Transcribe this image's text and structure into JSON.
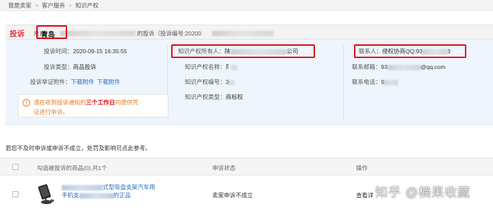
{
  "breadcrumb": [
    "我是卖家",
    "客户服务",
    "知识产权"
  ],
  "complaint": {
    "label": "投诉",
    "from_prefix": "来自",
    "city": "青岛",
    "suffix": "的投诉（投诉编号:20200"
  },
  "left_column": {
    "time_label": "投诉时间：",
    "time_value": "2020-09-15 16:35:55",
    "type_label": "投诉类型：",
    "type_value": "商品投诉",
    "attachment_label": "投诉举证附件：",
    "attachment_links": [
      "下载附件",
      "下载附件"
    ]
  },
  "notice": {
    "line1_before": "请在收到投诉通知的",
    "line1_highlight": "三个工作日",
    "line1_after": "内提供凭",
    "line2": "证进行申诉。"
  },
  "middle_column": {
    "owner_label": "知识产权所有人：",
    "owner_prefix": "陕",
    "owner_suffix": "公司",
    "name_label": "知识产权名称：",
    "name_prefix": "阝",
    "number_label": "知识产权编号：",
    "number_prefix": "3",
    "ip_type_label": "知识产权类型：",
    "ip_type_value": "商标权"
  },
  "right_column": {
    "contact_label": "联系人：",
    "contact_prefix": "侵权协商QQ:93",
    "contact_suffix": "3",
    "email_label": "联系邮箱：",
    "email_prefix": "93",
    "email_suffix": "@qq.com",
    "phone_label": "联系电话：",
    "phone_prefix": "9"
  },
  "hint": "若您不及时申诉或申诉不成立，处罚及影响可点此参考。",
  "table": {
    "headers": [
      "勾选被投诉的商品(0),共1个",
      "申诉状态",
      "操作"
    ],
    "row": {
      "name_line1_suffix": "式型吸盘支架汽车用",
      "name_line2_prefix": "手机支",
      "name_line2_suffix": "的正品",
      "status": "卖家申诉不成立",
      "action": "查看详"
    }
  },
  "watermark": "知乎 @楠果收藏",
  "colors": {
    "complaint_red": "#e4393c",
    "highlight_box": "#e4000f",
    "link_blue": "#2a6ebb",
    "warning_orange": "#e67e22",
    "panel_bg": "#eef5fc"
  }
}
